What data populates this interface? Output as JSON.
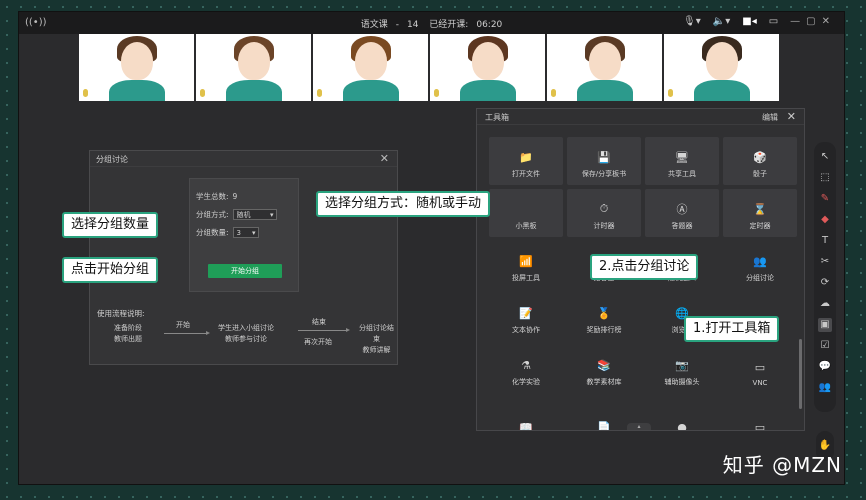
{
  "topbar": {
    "live_icon": "broadcast-icon",
    "course": "语文课",
    "separator": "-",
    "lesson": "14",
    "elapsed_label": "已经开课:",
    "elapsed": "06:20"
  },
  "students": [
    {
      "hair": "#5a3a24"
    },
    {
      "hair": "#6b4428"
    },
    {
      "hair": "#7a4a22"
    },
    {
      "hair": "#5c3620"
    },
    {
      "hair": "#5a3a24"
    },
    {
      "hair": "#3a2a1e"
    }
  ],
  "group_dialog": {
    "title": "分组讨论",
    "total_label": "学生总数:",
    "total_value": "9",
    "method_label": "分组方式:",
    "method_value": "随机",
    "count_label": "分组数量:",
    "count_value": "3",
    "start_button": "开始分组",
    "flow_title": "使用流程说明:",
    "flow": {
      "step1_line1": "准备阶段",
      "step1_line2": "教师出题",
      "arrow1": "开始",
      "step2_line1": "学生进入小组讨论",
      "step2_line2": "教师参与讨论",
      "arrow2_top": "结束",
      "arrow2_bottom": "再次开始",
      "step3_line1": "分组讨论结束",
      "step3_line2": "教师讲解"
    }
  },
  "callouts": {
    "method": "选择分组方式：随机或手动",
    "count": "选择分组数量",
    "start": "点击开始分组",
    "step2": "2.点击分组讨论",
    "step1": "1.打开工具箱"
  },
  "toolbox": {
    "title": "工具箱",
    "edit": "编辑",
    "items": [
      {
        "label": "打开文件",
        "icon": "📁",
        "boxed": true
      },
      {
        "label": "保存/分享板书",
        "icon": "💾",
        "boxed": true
      },
      {
        "label": "共享工具",
        "icon": "🖥",
        "boxed": true
      },
      {
        "label": "骰子",
        "icon": "🎲",
        "boxed": true
      },
      {
        "label": "小黑板",
        "icon": "",
        "boxed": true
      },
      {
        "label": "计时器",
        "icon": "⏱",
        "boxed": true
      },
      {
        "label": "答题器",
        "icon": "Ⓐ",
        "boxed": true
      },
      {
        "label": "定时器",
        "icon": "⌛",
        "boxed": true
      },
      {
        "label": "投屏工具",
        "icon": "📶",
        "boxed": false
      },
      {
        "label": "抢答器",
        "icon": "",
        "boxed": false
      },
      {
        "label": "随机选人",
        "icon": "",
        "boxed": false
      },
      {
        "label": "分组讨论",
        "icon": "👥",
        "boxed": false
      },
      {
        "label": "文本协作",
        "icon": "📝",
        "boxed": false
      },
      {
        "label": "奖励排行榜",
        "icon": "🏅",
        "boxed": false
      },
      {
        "label": "浏览器",
        "icon": "🌐",
        "boxed": false
      },
      {
        "label": "",
        "icon": "",
        "boxed": false
      },
      {
        "label": "化学实验",
        "icon": "⚗",
        "boxed": false
      },
      {
        "label": "教学素材库",
        "icon": "📚",
        "boxed": false
      },
      {
        "label": "辅助摄像头",
        "icon": "📷",
        "boxed": false
      },
      {
        "label": "VNC",
        "icon": "▭",
        "boxed": false
      },
      {
        "label": "",
        "icon": "📖",
        "boxed": false
      },
      {
        "label": "",
        "icon": "📄",
        "boxed": false
      },
      {
        "label": "",
        "icon": "●",
        "boxed": false
      },
      {
        "label": "",
        "icon": "▭",
        "boxed": false
      }
    ]
  },
  "sidebar_icons": [
    {
      "icon": "↖",
      "name": "pointer-icon",
      "active": false
    },
    {
      "icon": "⬚",
      "name": "select-icon",
      "active": false
    },
    {
      "icon": "✎",
      "name": "pen-icon",
      "active": false,
      "red": true
    },
    {
      "icon": "◆",
      "name": "eraser-icon",
      "active": false,
      "red": true
    },
    {
      "icon": "T",
      "name": "text-icon",
      "active": false
    },
    {
      "icon": "✂",
      "name": "scissors-icon",
      "active": false
    },
    {
      "icon": "⟳",
      "name": "undo-icon",
      "active": false
    },
    {
      "icon": "☁",
      "name": "cloud-icon",
      "active": false
    },
    {
      "icon": "▣",
      "name": "toolbox-icon",
      "active": true
    },
    {
      "icon": "☑",
      "name": "checklist-icon",
      "active": false
    },
    {
      "icon": "💬",
      "name": "chat-icon",
      "active": false
    },
    {
      "icon": "👥",
      "name": "users-icon",
      "active": false
    }
  ],
  "watermark": "知乎 @MZN"
}
